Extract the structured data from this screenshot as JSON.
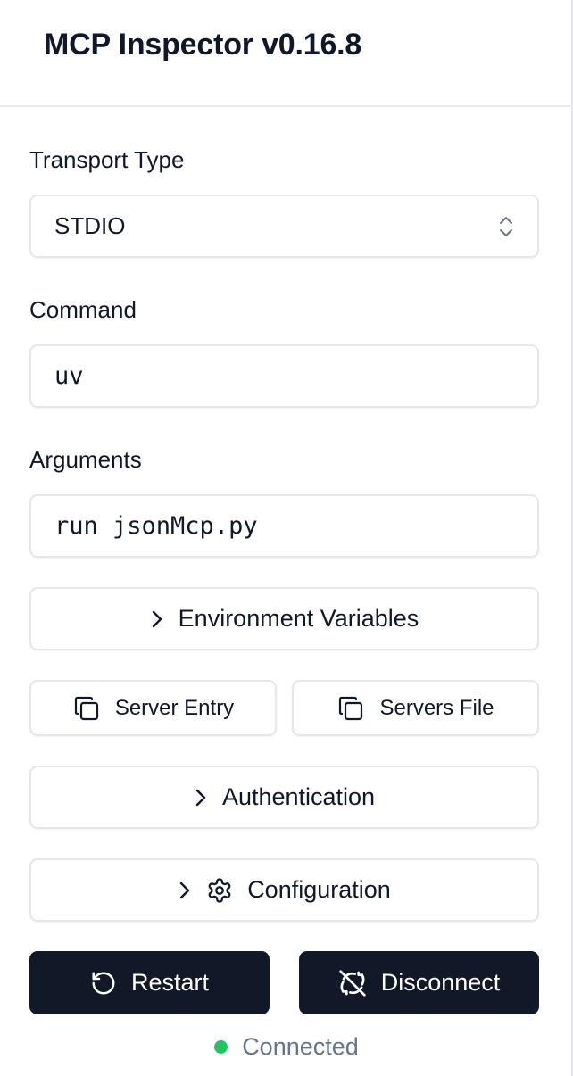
{
  "header": {
    "title": "MCP Inspector v0.16.8"
  },
  "transport": {
    "label": "Transport Type",
    "selected": "STDIO",
    "icon": "chevron-up-down-icon"
  },
  "command": {
    "label": "Command",
    "value": "uv"
  },
  "arguments": {
    "label": "Arguments",
    "value": "run jsonMcp.py"
  },
  "sections": {
    "environment": {
      "label": "Environment Variables",
      "icon": "chevron-right-icon"
    },
    "authentication": {
      "label": "Authentication",
      "icon": "chevron-right-icon"
    },
    "configuration": {
      "label": "Configuration",
      "icon": "gear-icon"
    }
  },
  "copy_buttons": {
    "server_entry": {
      "label": "Server Entry",
      "icon": "copy-icon"
    },
    "servers_file": {
      "label": "Servers File",
      "icon": "copy-icon"
    }
  },
  "actions": {
    "restart": {
      "label": "Restart",
      "icon": "restart-icon"
    },
    "disconnect": {
      "label": "Disconnect",
      "icon": "disconnect-icon"
    }
  },
  "status": {
    "text": "Connected",
    "color": "#22c55e"
  },
  "colors": {
    "primary_dark": "#111827",
    "border": "#e5e7eb",
    "muted_text": "#64748b"
  }
}
